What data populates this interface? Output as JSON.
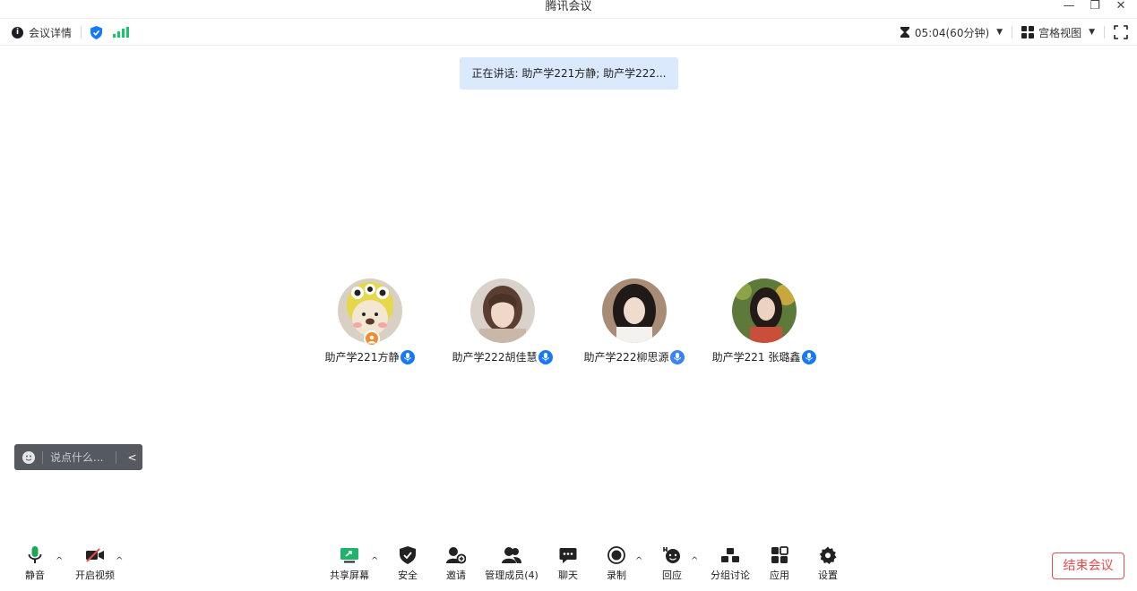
{
  "app": {
    "title": "腾讯会议"
  },
  "window_controls": {
    "minimize": "—",
    "restore": "❐",
    "close": "✕"
  },
  "infobar": {
    "meeting_details": "会议详情",
    "info_icon": "i",
    "timer": "05:04(60分钟)",
    "view_mode": "宫格视图"
  },
  "speaking": {
    "text": "正在讲话: 助产学221方静; 助产学222..."
  },
  "participants": [
    {
      "name": "助产学221方静",
      "avatar": "bear-avatar",
      "host": true
    },
    {
      "name": "助产学222胡佳慧",
      "avatar": "photo-avatar",
      "host": false
    },
    {
      "name": "助产学222柳思源",
      "avatar": "photo-avatar",
      "host": false
    },
    {
      "name": "助产学221 张璐鑫",
      "avatar": "photo-avatar",
      "host": false
    }
  ],
  "chat": {
    "placeholder": "说点什么...",
    "collapse": "<"
  },
  "toolbar": {
    "mute": "静音",
    "video": "开启视频",
    "share": "共享屏幕",
    "security": "安全",
    "invite": "邀请",
    "members": "管理成员(4)",
    "chat": "聊天",
    "record": "录制",
    "reactions": "回应",
    "breakout": "分组讨论",
    "apps": "应用",
    "settings": "设置",
    "caret": "^"
  },
  "end_meeting": "结束会议",
  "colors": {
    "accent": "#1677ff",
    "danger": "#e84b4b",
    "signal": "#17c964",
    "share": "#1fb36b"
  }
}
